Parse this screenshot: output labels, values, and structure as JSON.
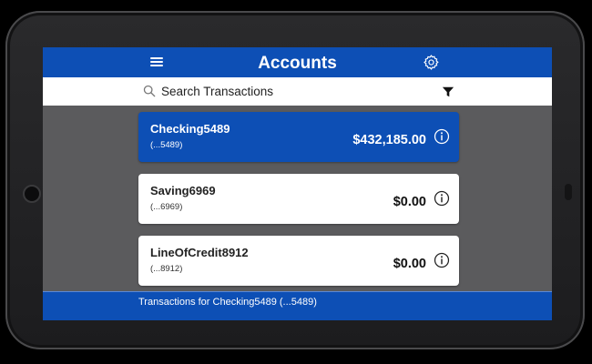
{
  "header": {
    "title": "Accounts",
    "menu_icon": "hamburger-menu-icon",
    "settings_icon": "gear-icon"
  },
  "search": {
    "placeholder": "Search Transactions",
    "search_icon": "search-icon",
    "filter_icon": "filter-icon"
  },
  "accounts": [
    {
      "name": "Checking5489",
      "number": "(...5489)",
      "balance": "$432,185.00",
      "selected": true
    },
    {
      "name": "Saving6969",
      "number": "(...6969)",
      "balance": "$0.00",
      "selected": false
    },
    {
      "name": "LineOfCredit8912",
      "number": "(...8912)",
      "balance": "$0.00",
      "selected": false
    }
  ],
  "footer": {
    "text": "Transactions for Checking5489 (...5489)"
  },
  "colors": {
    "brand_blue": "#0d4fb5",
    "screen_bg": "#5b5b5d",
    "card_bg": "#ffffff"
  }
}
